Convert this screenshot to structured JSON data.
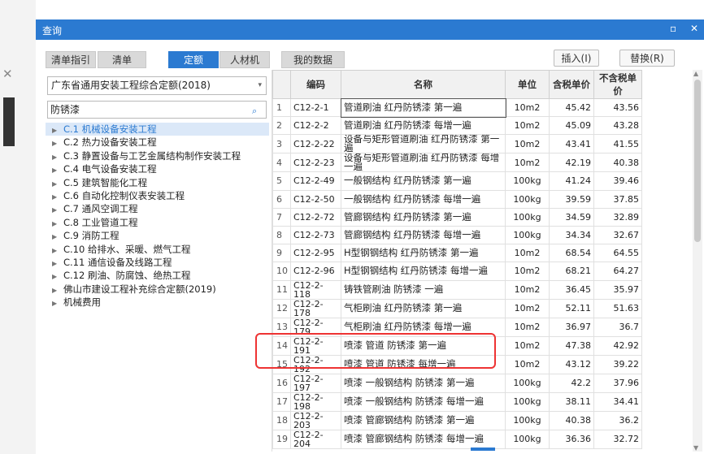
{
  "window": {
    "title": "查询",
    "restore_glyph": "▫",
    "close_glyph": "✕"
  },
  "tabs": [
    {
      "label": "清单指引"
    },
    {
      "label": "清单"
    },
    {
      "label": "定额",
      "active": true
    },
    {
      "label": "人材机"
    },
    {
      "label": "我的数据"
    }
  ],
  "buttons": {
    "insert": "插入(I)",
    "replace": "替换(R)"
  },
  "left": {
    "library_select": "广东省通用安装工程综合定额(2018)",
    "search_value": "防锈漆",
    "tree": [
      "C.1 机械设备安装工程",
      "C.2 热力设备安装工程",
      "C.3 静置设备与工艺金属结构制作安装工程",
      "C.4 电气设备安装工程",
      "C.5 建筑智能化工程",
      "C.6 自动化控制仪表安装工程",
      "C.7 通风空调工程",
      "C.8 工业管道工程",
      "C.9 消防工程",
      "C.10 给排水、采暖、燃气工程",
      "C.11 通信设备及线路工程",
      "C.12 刷油、防腐蚀、绝热工程",
      "佛山市建设工程补充综合定额(2019)",
      "机械费用"
    ]
  },
  "table": {
    "headers": [
      "",
      "编码",
      "名称",
      "单位",
      "含税单价",
      "不含税单价"
    ],
    "rows": [
      [
        "1",
        "C12-2-1",
        "管道刷油 红丹防锈漆 第一遍",
        "10m2",
        "45.42",
        "43.56"
      ],
      [
        "2",
        "C12-2-2",
        "管道刷油 红丹防锈漆 每增一遍",
        "10m2",
        "45.09",
        "43.28"
      ],
      [
        "3",
        "C12-2-22",
        "设备与矩形管道刷油 红丹防锈漆 第一遍",
        "10m2",
        "43.41",
        "41.55"
      ],
      [
        "4",
        "C12-2-23",
        "设备与矩形管道刷油 红丹防锈漆 每增一遍",
        "10m2",
        "42.19",
        "40.38"
      ],
      [
        "5",
        "C12-2-49",
        "一般钢结构 红丹防锈漆 第一遍",
        "100kg",
        "41.24",
        "39.46"
      ],
      [
        "6",
        "C12-2-50",
        "一般钢结构 红丹防锈漆 每增一遍",
        "100kg",
        "39.59",
        "37.85"
      ],
      [
        "7",
        "C12-2-72",
        "管廊钢结构 红丹防锈漆 第一遍",
        "100kg",
        "34.59",
        "32.89"
      ],
      [
        "8",
        "C12-2-73",
        "管廊钢结构 红丹防锈漆 每增一遍",
        "100kg",
        "34.34",
        "32.67"
      ],
      [
        "9",
        "C12-2-95",
        "H型钢钢结构 红丹防锈漆 第一遍",
        "10m2",
        "68.54",
        "64.55"
      ],
      [
        "10",
        "C12-2-96",
        "H型钢钢结构 红丹防锈漆 每增一遍",
        "10m2",
        "68.21",
        "64.27"
      ],
      [
        "11",
        "C12-2-118",
        "铸铁管刷油 防锈漆 一遍",
        "10m2",
        "36.45",
        "35.97"
      ],
      [
        "12",
        "C12-2-178",
        "气柜刷油 红丹防锈漆 第一遍",
        "10m2",
        "52.11",
        "51.63"
      ],
      [
        "13",
        "C12-2-179",
        "气柜刷油 红丹防锈漆 每增一遍",
        "10m2",
        "36.97",
        "36.7"
      ],
      [
        "14",
        "C12-2-191",
        "喷漆 管道 防锈漆 第一遍",
        "10m2",
        "47.38",
        "42.92"
      ],
      [
        "15",
        "C12-2-192",
        "喷漆 管道 防锈漆 每增一遍",
        "10m2",
        "43.12",
        "39.22"
      ],
      [
        "16",
        "C12-2-197",
        "喷漆 一般钢结构 防锈漆 第一遍",
        "100kg",
        "42.2",
        "37.96"
      ],
      [
        "17",
        "C12-2-198",
        "喷漆 一般钢结构 防锈漆 每增一遍",
        "100kg",
        "38.11",
        "34.41"
      ],
      [
        "18",
        "C12-2-203",
        "喷漆 管廊钢结构 防锈漆 第一遍",
        "100kg",
        "40.38",
        "36.2"
      ],
      [
        "19",
        "C12-2-204",
        "喷漆 管廊钢结构 防锈漆 每增一遍",
        "100kg",
        "36.36",
        "32.72"
      ]
    ]
  },
  "accent": "#2b7ad1",
  "highlight_color": "#e33333"
}
